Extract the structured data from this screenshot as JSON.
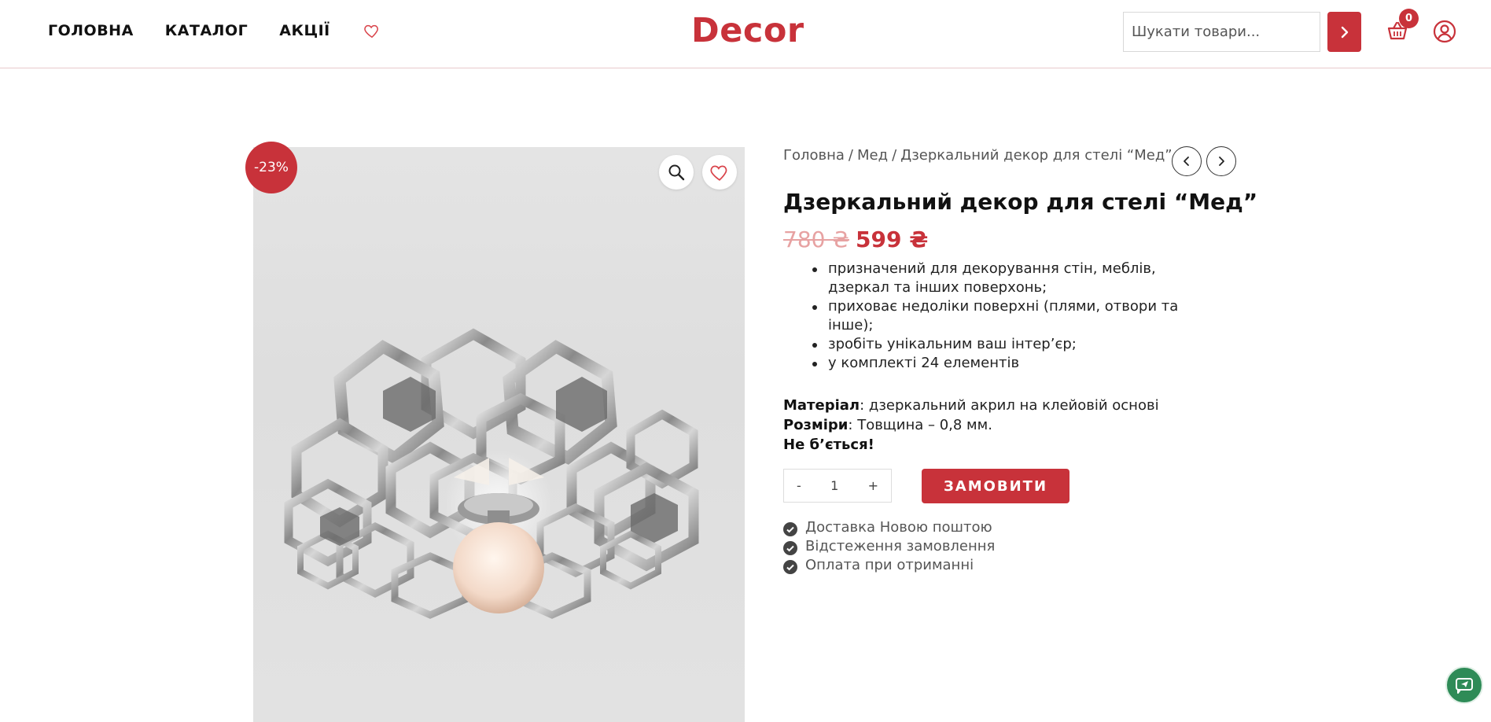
{
  "header": {
    "nav": [
      {
        "label": "ГОЛОВНА"
      },
      {
        "label": "КАТАЛОГ"
      },
      {
        "label": "АКЦІЇ"
      }
    ],
    "logo": "Decor",
    "search": {
      "placeholder": "Шукати товари..."
    },
    "cart": {
      "count": "0"
    }
  },
  "product": {
    "discount_badge": "-23%",
    "breadcrumb": [
      "Головна",
      "Мед",
      "Дзеркальний декор для стелі “Мед”"
    ],
    "breadcrumb_sep": "/",
    "title": "Дзеркальний декор для стелі “Мед”",
    "price": {
      "old": "780 ₴",
      "new": "599 ₴"
    },
    "features": [
      "призначений для декорування стін, меблів, дзеркал та інших поверхонь;",
      "приховає недоліки поверхні (плями, отвори та інше);",
      "зробіть унікальним ваш інтер’єр;",
      "у комплекті 24 елементів"
    ],
    "specs": {
      "material_label": "Матеріал",
      "material_value": ": дзеркальний акрил на клейовій основі",
      "size_label": "Розміри",
      "size_value": ": Товщина – 0,8 мм.",
      "unbreakable": "Не б’ється!"
    },
    "quantity": {
      "minus": "-",
      "value": "1",
      "plus": "+"
    },
    "order_button": "ЗАМОВИТИ",
    "benefits": [
      "Доставка Новою поштою",
      "Відстеження замовлення",
      "Оплата при отриманні"
    ]
  },
  "colors": {
    "accent": "#c8323a",
    "old_price": "#e7a2a2",
    "chat": "#2e8b57"
  }
}
